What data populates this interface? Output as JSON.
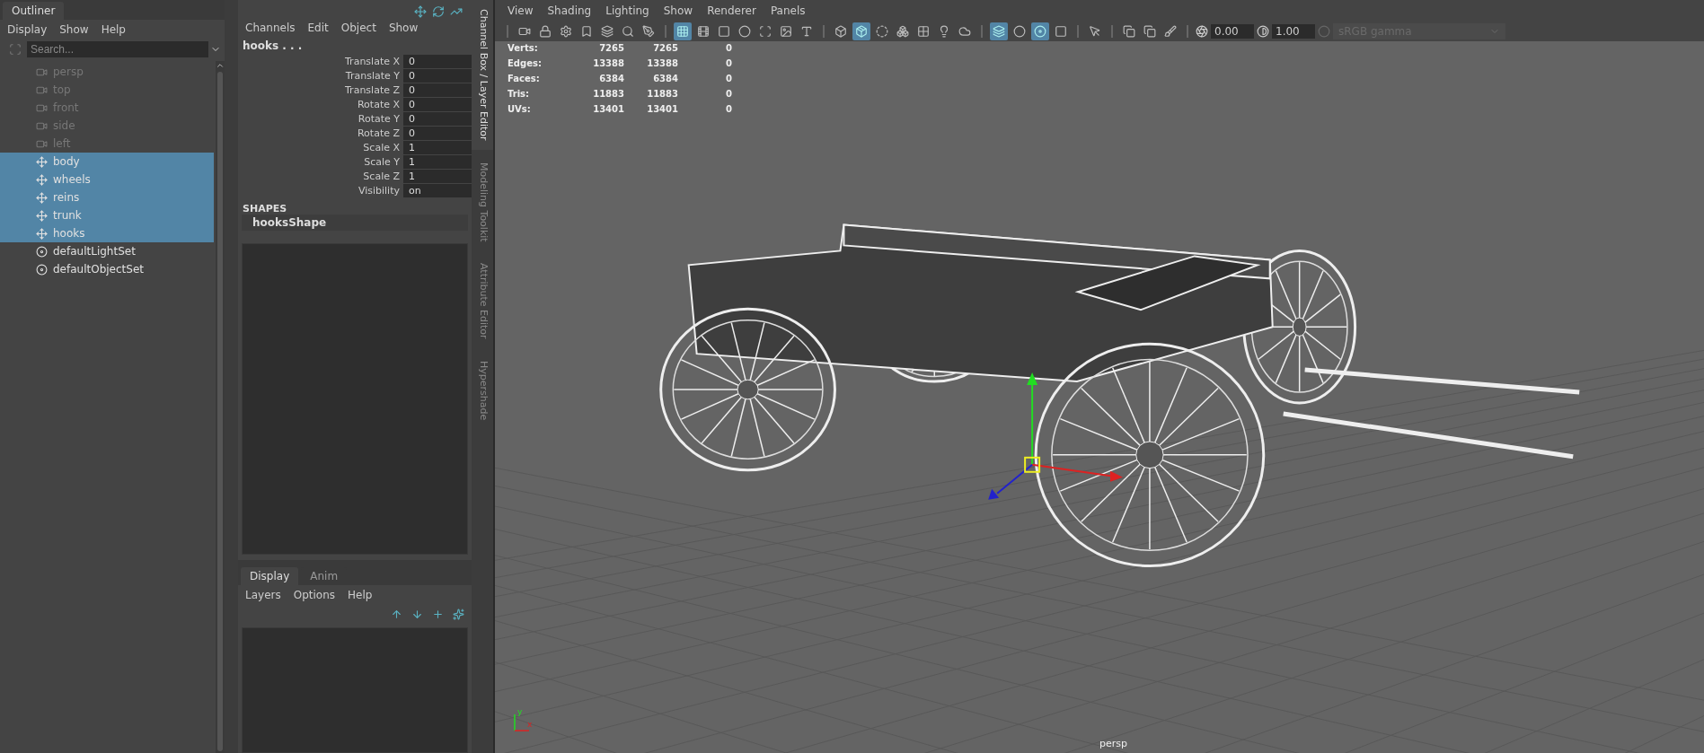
{
  "outliner": {
    "title": "Outliner",
    "menu": [
      "Display",
      "Show",
      "Help"
    ],
    "search": {
      "placeholder": "Search..."
    },
    "items": [
      {
        "label": "persp",
        "kind": "camera",
        "selected": false,
        "hidden": true
      },
      {
        "label": "top",
        "kind": "camera",
        "selected": false,
        "hidden": true
      },
      {
        "label": "front",
        "kind": "camera",
        "selected": false,
        "hidden": true
      },
      {
        "label": "side",
        "kind": "camera",
        "selected": false,
        "hidden": true
      },
      {
        "label": "left",
        "kind": "camera",
        "selected": false,
        "hidden": true
      },
      {
        "label": "body",
        "kind": "transform",
        "selected": true,
        "hidden": false
      },
      {
        "label": "wheels",
        "kind": "transform",
        "selected": true,
        "hidden": false
      },
      {
        "label": "reins",
        "kind": "transform",
        "selected": true,
        "hidden": false
      },
      {
        "label": "trunk",
        "kind": "transform",
        "selected": true,
        "hidden": false
      },
      {
        "label": "hooks",
        "kind": "transform",
        "selected": true,
        "hidden": false
      },
      {
        "label": "defaultLightSet",
        "kind": "set",
        "selected": false,
        "hidden": false
      },
      {
        "label": "defaultObjectSet",
        "kind": "set",
        "selected": false,
        "hidden": false
      }
    ]
  },
  "channel_box": {
    "menu": [
      "Channels",
      "Edit",
      "Object",
      "Show"
    ],
    "object": "hooks . . .",
    "channels": [
      {
        "label": "Translate X",
        "value": "0"
      },
      {
        "label": "Translate Y",
        "value": "0"
      },
      {
        "label": "Translate Z",
        "value": "0"
      },
      {
        "label": "Rotate X",
        "value": "0"
      },
      {
        "label": "Rotate Y",
        "value": "0"
      },
      {
        "label": "Rotate Z",
        "value": "0"
      },
      {
        "label": "Scale X",
        "value": "1"
      },
      {
        "label": "Scale Y",
        "value": "1"
      },
      {
        "label": "Scale Z",
        "value": "1"
      },
      {
        "label": "Visibility",
        "value": "on"
      }
    ],
    "shapes_heading": "SHAPES",
    "shape": "hooksShape"
  },
  "side_tabs": [
    {
      "label": "Channel Box / Layer Editor",
      "selected": true
    },
    {
      "label": "Modeling Toolkit",
      "selected": false
    },
    {
      "label": "Attribute Editor",
      "selected": false
    },
    {
      "label": "Hypershade",
      "selected": false
    }
  ],
  "layer_editor": {
    "tabs": [
      {
        "label": "Display",
        "selected": true
      },
      {
        "label": "Anim",
        "selected": false
      }
    ],
    "menu": [
      "Layers",
      "Options",
      "Help"
    ]
  },
  "viewport": {
    "menu": [
      "View",
      "Shading",
      "Lighting",
      "Show",
      "Renderer",
      "Panels"
    ],
    "toolbar": [
      [
        {
          "kind": "camera",
          "on": false
        },
        {
          "kind": "lock",
          "on": false
        },
        {
          "kind": "gear",
          "on": false
        },
        {
          "kind": "bookmark",
          "on": false
        },
        {
          "kind": "layers",
          "on": false
        },
        {
          "kind": "magnify",
          "on": false
        },
        {
          "kind": "pen",
          "on": false
        }
      ],
      [
        {
          "kind": "grid",
          "on": true
        },
        {
          "kind": "film",
          "on": false
        },
        {
          "kind": "square",
          "on": false
        },
        {
          "kind": "circle",
          "on": false
        },
        {
          "kind": "scan",
          "on": false
        },
        {
          "kind": "image",
          "on": false
        },
        {
          "kind": "type",
          "on": false
        }
      ],
      [
        {
          "kind": "box",
          "on": false
        },
        {
          "kind": "package",
          "on": true
        },
        {
          "kind": "circle-half",
          "on": false
        },
        {
          "kind": "boxes",
          "on": false
        },
        {
          "kind": "checker",
          "on": false
        },
        {
          "kind": "bulb",
          "on": false
        },
        {
          "kind": "cloud",
          "on": false
        }
      ],
      [
        {
          "kind": "layers",
          "on": true
        },
        {
          "kind": "circle",
          "on": false
        },
        {
          "kind": "disc",
          "on": true
        },
        {
          "kind": "square",
          "on": false
        }
      ],
      [
        {
          "kind": "pointer",
          "on": false
        }
      ],
      [
        {
          "kind": "copy",
          "on": false
        },
        {
          "kind": "copy",
          "on": false
        },
        {
          "kind": "brush",
          "on": false
        }
      ]
    ],
    "exposure": "0.00",
    "gamma": "1.00",
    "color_space": {
      "value": "sRGB gamma",
      "disabled": true
    },
    "stats": [
      {
        "label": "Verts:",
        "values": [
          "7265",
          "7265",
          "0"
        ]
      },
      {
        "label": "Edges:",
        "values": [
          "13388",
          "13388",
          "0"
        ]
      },
      {
        "label": "Faces:",
        "values": [
          "6384",
          "6384",
          "0"
        ]
      },
      {
        "label": "Tris:",
        "values": [
          "11883",
          "11883",
          "0"
        ]
      },
      {
        "label": "UVs:",
        "values": [
          "13401",
          "13401",
          "0"
        ]
      }
    ],
    "axis_labels": [
      "y",
      "x"
    ],
    "camera": "persp"
  }
}
